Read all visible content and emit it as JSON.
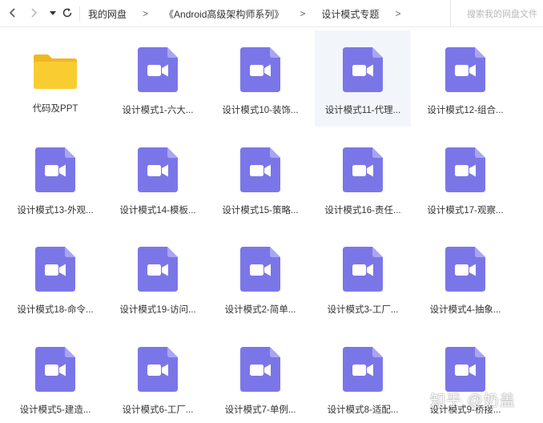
{
  "nav": {
    "back_icon": "chevron-left-icon",
    "forward_icon": "chevron-right-icon",
    "history_icon": "caret-down-icon",
    "refresh_icon": "refresh-icon"
  },
  "breadcrumb": {
    "items": [
      "我的网盘",
      "《Android高级架构师系列》",
      "设计模式专题"
    ],
    "separator": ">"
  },
  "search": {
    "placeholder": "搜索我的网盘文件"
  },
  "colors": {
    "video_icon": "#7b76e8",
    "video_icon_fold": "#a9a5f2",
    "folder": "#f9cc32",
    "folder_tab": "#f0b81f",
    "selected_bg": "#f2f6fb"
  },
  "files": [
    {
      "name": "代码及PPT",
      "type": "folder"
    },
    {
      "name": "设计模式1-六大...",
      "type": "video"
    },
    {
      "name": "设计模式10-装饰...",
      "type": "video"
    },
    {
      "name": "设计模式11-代理...",
      "type": "video",
      "selected": true
    },
    {
      "name": "设计模式12-组合...",
      "type": "video"
    },
    {
      "name": "设计模式13-外观...",
      "type": "video"
    },
    {
      "name": "设计模式14-模板...",
      "type": "video"
    },
    {
      "name": "设计模式15-策略...",
      "type": "video"
    },
    {
      "name": "设计模式16-责任...",
      "type": "video"
    },
    {
      "name": "设计模式17-观察...",
      "type": "video"
    },
    {
      "name": "设计模式18-命令...",
      "type": "video"
    },
    {
      "name": "设计模式19-访问...",
      "type": "video"
    },
    {
      "name": "设计模式2-简单...",
      "type": "video"
    },
    {
      "name": "设计模式3-工厂...",
      "type": "video"
    },
    {
      "name": "设计模式4-抽象...",
      "type": "video"
    },
    {
      "name": "设计模式5-建造...",
      "type": "video"
    },
    {
      "name": "设计模式6-工厂...",
      "type": "video"
    },
    {
      "name": "设计模式7-单例...",
      "type": "video"
    },
    {
      "name": "设计模式8-适配...",
      "type": "video"
    },
    {
      "name": "设计模式9-桥接...",
      "type": "video"
    }
  ],
  "watermark": "知乎 @奶盖"
}
